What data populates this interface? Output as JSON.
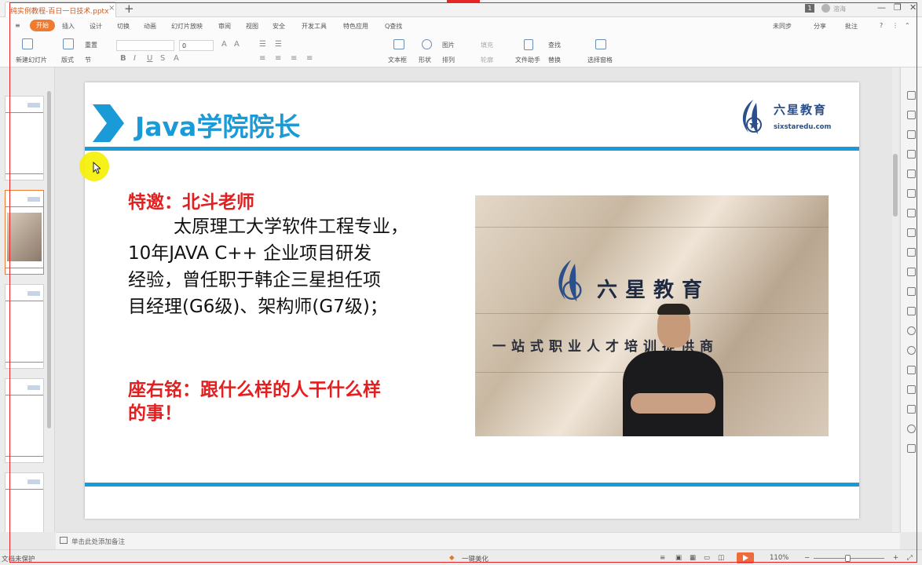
{
  "titlebar": {
    "doc_tab": "纯实例教程-百日一日技术.pptx",
    "badge": "1",
    "user": "溶海"
  },
  "menu": {
    "tabs": [
      "开始",
      "插入",
      "设计",
      "切换",
      "动画",
      "幻灯片放映",
      "审阅",
      "视图",
      "安全",
      "开发工具",
      "特色应用"
    ],
    "search": "Q查找",
    "right_items": [
      "未同步",
      "分享",
      "批注"
    ]
  },
  "toolbar": {
    "new_slide": "新建幻灯片",
    "layout": "版式",
    "reset": "重置",
    "section": "节",
    "font_size": "0",
    "textbox": "文本框",
    "shape": "形状",
    "arrange": "排列",
    "picture": "图片",
    "fill": "填充",
    "outline": "轮廓",
    "file_assistant": "文件助手",
    "find": "查找",
    "replace": "替换",
    "select_pane": "选择窗格"
  },
  "slide": {
    "title": "Java学院院长",
    "brand_name": "六星教育",
    "brand_url": "sixstaredu.com",
    "guest": "特邀：北斗老师",
    "bio_lines": [
      "太原理工大学软件工程专业，",
      "10年JAVA  C++   企业项目研发",
      "经验，曾任职于韩企三星担任项",
      "目经理(G6级)、架构师(G7级)；"
    ],
    "motto_lines": [
      "座右铭：跟什么样的人干什么样",
      "的事！"
    ],
    "photo_name": "六星教育",
    "photo_slogan": "一站式职业人才培训提供商"
  },
  "notes": {
    "placeholder": "单击此处添加备注"
  },
  "status": {
    "left": "文档未保护",
    "beautify": "一键美化",
    "zoom": "110%"
  },
  "colors": {
    "accent": "#1a9ad6",
    "highlight": "#e41f1f",
    "ribbon_active": "#ee7b2f"
  }
}
